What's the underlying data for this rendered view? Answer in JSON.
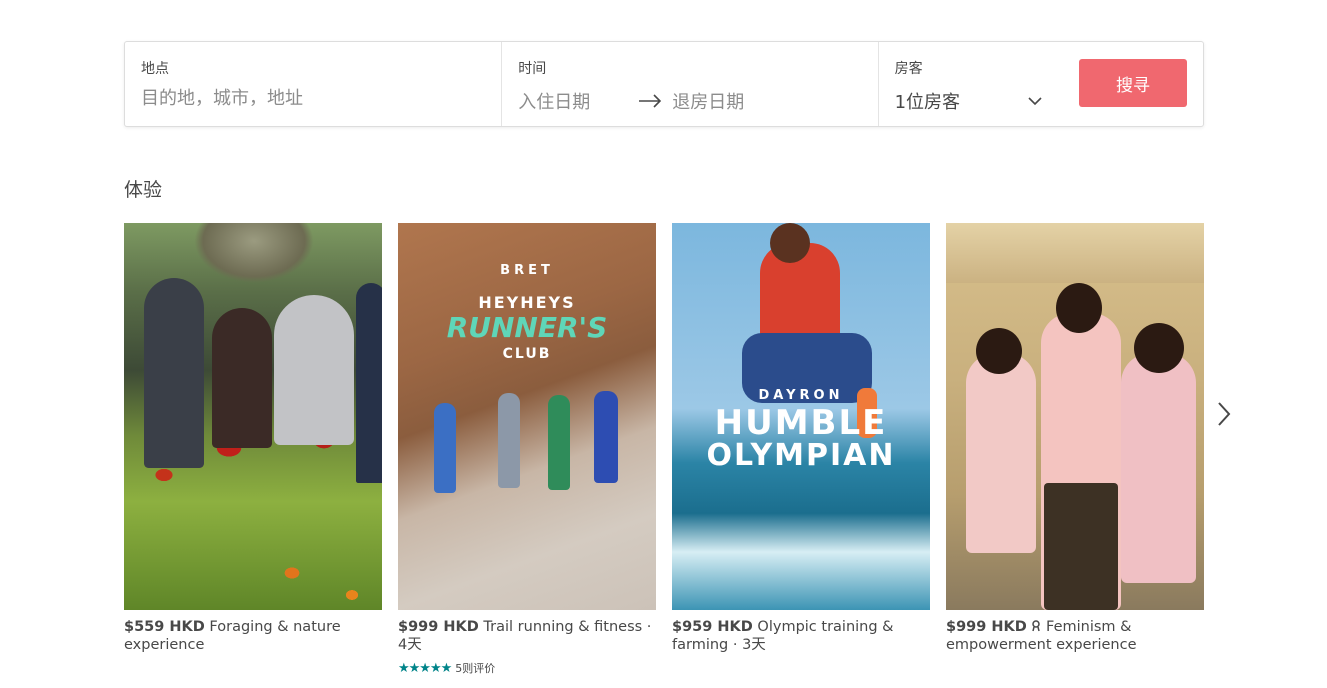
{
  "search": {
    "location_label": "地点",
    "location_placeholder": "目的地，城市，地址",
    "dates_label": "时间",
    "checkin": "入住日期",
    "checkout": "退房日期",
    "guests_label": "房客",
    "guests_value": "1位房客",
    "button_label": "搜寻"
  },
  "section": {
    "title": "体验"
  },
  "cards": [
    {
      "price": "$559 HKD",
      "title": "Foraging & nature experience"
    },
    {
      "price": "$999 HKD",
      "title": "Trail running & fitness · 4天",
      "image_text": {
        "top": "BRET",
        "line1": "HEYHEYS",
        "line2": "RUNNER'S",
        "line3": "CLUB"
      },
      "stars": "★★★★★",
      "rating_text": "5则评价"
    },
    {
      "price": "$959 HKD",
      "title": "Olympic training & farming · 3天",
      "image_text": {
        "top": "DAYRON",
        "line1": "HUMBLE",
        "line2": "OLYMPIAN"
      }
    },
    {
      "price": "$999 HKD",
      "badge_icon": "ribbon-icon",
      "title": "Feminism & empowerment experience"
    }
  ],
  "colors": {
    "accent": "#f0686f",
    "stars": "#008489"
  }
}
